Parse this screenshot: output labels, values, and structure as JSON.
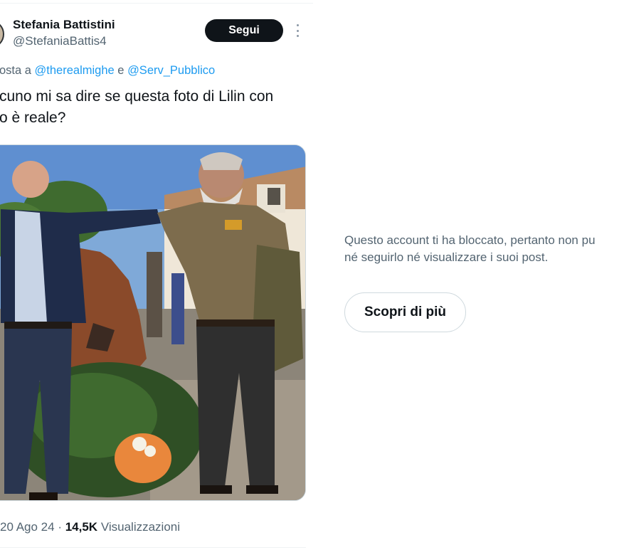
{
  "tweet": {
    "author_name": "Stefania Battistini",
    "author_handle": "@StefaniaBattis4",
    "follow_label": "Segui",
    "reply_prefix": "osta a",
    "reply_mention_1": "@therealmighe",
    "reply_joiner": "e",
    "reply_mention_2": "@Serv_Pubblico",
    "text_line_1": "cuno mi sa dire se questa foto di Lilin con",
    "text_line_2": "o è reale?",
    "date": "20 Ago 24",
    "separator": "·",
    "views_count": "14,5K",
    "views_label": "Visualizzazioni"
  },
  "blocked_notice": {
    "line_1": "Questo account ti ha bloccato, pertanto non pu",
    "line_2": "né seguirlo né visualizzare i suoi post.",
    "learn_more_label": "Scopri di più"
  },
  "icons": {
    "more": "more-vertical-icon",
    "avatar": "avatar"
  },
  "colors": {
    "text_primary": "#0f1419",
    "text_secondary": "#536471",
    "link": "#1d9bf0",
    "follow_button_bg": "#0f1419",
    "border": "#cfd9de"
  }
}
